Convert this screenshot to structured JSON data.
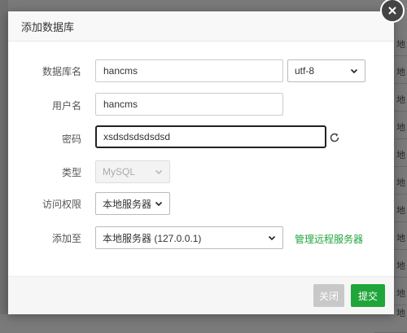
{
  "dialog": {
    "title": "添加数据库",
    "close_icon": "close-icon"
  },
  "form": {
    "db_name_label": "数据库名",
    "db_name_value": "hancms",
    "charset_value": "utf-8",
    "username_label": "用户名",
    "username_value": "hancms",
    "password_label": "密码",
    "password_value": "xsdsdsdsdsdsd",
    "refresh_icon": "refresh-icon",
    "type_label": "类型",
    "type_value": "MySQL",
    "access_label": "访问权限",
    "access_value": "本地服务器",
    "add_to_label": "添加至",
    "add_to_value": "本地服务器 (127.0.0.1)",
    "manage_remote_link": "管理远程服务器"
  },
  "footer": {
    "close_label": "关闭",
    "submit_label": "提交"
  },
  "background": {
    "cells": [
      "地",
      "地",
      "地",
      "地",
      "地",
      "地",
      "地",
      "地",
      "地",
      "地",
      "地"
    ]
  },
  "colors": {
    "accent": "#20a53a",
    "disabled_button": "#c8c8c8",
    "overlay": "#7a7a7a"
  }
}
